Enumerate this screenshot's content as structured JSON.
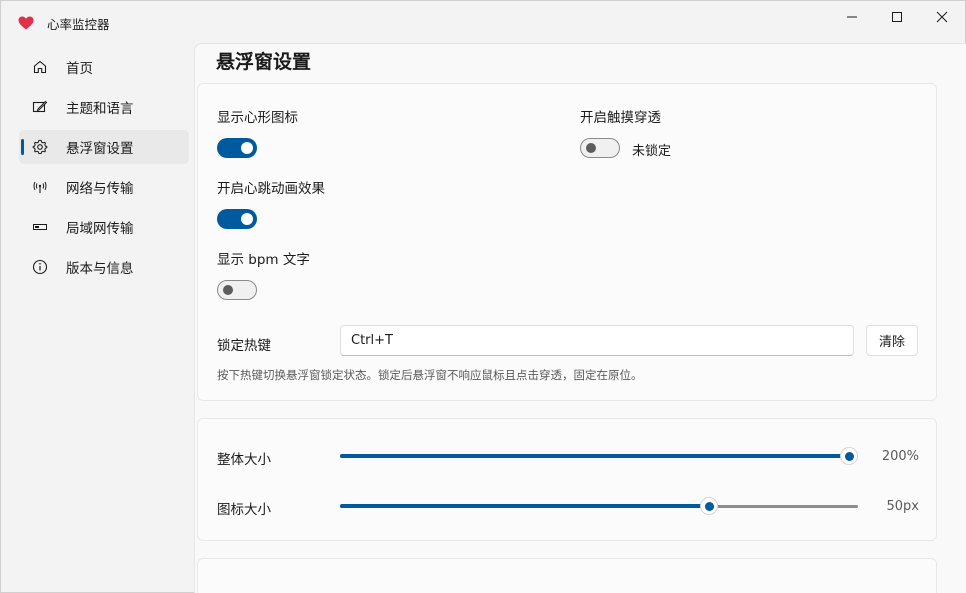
{
  "app": {
    "title": "心率监控器",
    "brand_color": "#e0304a",
    "accent": "#005a9e"
  },
  "window_controls": {
    "minimize_icon": "minimize-icon",
    "maximize_icon": "maximize-icon",
    "close_icon": "close-icon"
  },
  "sidebar": {
    "items": [
      {
        "label": "首页",
        "icon": "home-icon",
        "active": false
      },
      {
        "label": "主题和语言",
        "icon": "theme-icon",
        "active": false
      },
      {
        "label": "悬浮窗设置",
        "icon": "gear-icon",
        "active": true
      },
      {
        "label": "网络与传输",
        "icon": "antenna-icon",
        "active": false
      },
      {
        "label": "局域网传输",
        "icon": "lan-icon",
        "active": false
      },
      {
        "label": "版本与信息",
        "icon": "info-icon",
        "active": false
      }
    ]
  },
  "page": {
    "title": "悬浮窗设置"
  },
  "overlay_settings": {
    "show_heart_icon": {
      "label": "显示心形图标",
      "on": true
    },
    "heartbeat_animation": {
      "label": "开启心跳动画效果",
      "on": true
    },
    "show_bpm_text": {
      "label": "显示 bpm 文字",
      "on": false
    },
    "touch_through": {
      "label": "开启触摸穿透",
      "on": false,
      "state_text": "未锁定"
    },
    "hotkey": {
      "label": "锁定热键",
      "value": "Ctrl+T",
      "clear_label": "清除",
      "hint": "按下热键切换悬浮窗锁定状态。锁定后悬浮窗不响应鼠标且点击穿透，固定在原位。"
    }
  },
  "size_settings": {
    "overall_size": {
      "label": "整体大小",
      "value_text": "200%",
      "fraction": 1.0
    },
    "icon_size": {
      "label": "图标大小",
      "value_text": "50px",
      "fraction": 0.72
    }
  }
}
